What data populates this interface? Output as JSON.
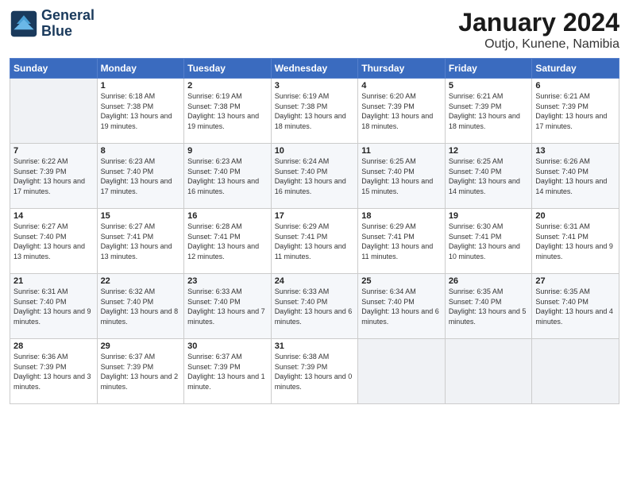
{
  "logo": {
    "line1": "General",
    "line2": "Blue"
  },
  "title": "January 2024",
  "location": "Outjo, Kunene, Namibia",
  "headers": [
    "Sunday",
    "Monday",
    "Tuesday",
    "Wednesday",
    "Thursday",
    "Friday",
    "Saturday"
  ],
  "weeks": [
    [
      {
        "num": "",
        "sunrise": "",
        "sunset": "",
        "daylight": ""
      },
      {
        "num": "1",
        "sunrise": "Sunrise: 6:18 AM",
        "sunset": "Sunset: 7:38 PM",
        "daylight": "Daylight: 13 hours and 19 minutes."
      },
      {
        "num": "2",
        "sunrise": "Sunrise: 6:19 AM",
        "sunset": "Sunset: 7:38 PM",
        "daylight": "Daylight: 13 hours and 19 minutes."
      },
      {
        "num": "3",
        "sunrise": "Sunrise: 6:19 AM",
        "sunset": "Sunset: 7:38 PM",
        "daylight": "Daylight: 13 hours and 18 minutes."
      },
      {
        "num": "4",
        "sunrise": "Sunrise: 6:20 AM",
        "sunset": "Sunset: 7:39 PM",
        "daylight": "Daylight: 13 hours and 18 minutes."
      },
      {
        "num": "5",
        "sunrise": "Sunrise: 6:21 AM",
        "sunset": "Sunset: 7:39 PM",
        "daylight": "Daylight: 13 hours and 18 minutes."
      },
      {
        "num": "6",
        "sunrise": "Sunrise: 6:21 AM",
        "sunset": "Sunset: 7:39 PM",
        "daylight": "Daylight: 13 hours and 17 minutes."
      }
    ],
    [
      {
        "num": "7",
        "sunrise": "Sunrise: 6:22 AM",
        "sunset": "Sunset: 7:39 PM",
        "daylight": "Daylight: 13 hours and 17 minutes."
      },
      {
        "num": "8",
        "sunrise": "Sunrise: 6:23 AM",
        "sunset": "Sunset: 7:40 PM",
        "daylight": "Daylight: 13 hours and 17 minutes."
      },
      {
        "num": "9",
        "sunrise": "Sunrise: 6:23 AM",
        "sunset": "Sunset: 7:40 PM",
        "daylight": "Daylight: 13 hours and 16 minutes."
      },
      {
        "num": "10",
        "sunrise": "Sunrise: 6:24 AM",
        "sunset": "Sunset: 7:40 PM",
        "daylight": "Daylight: 13 hours and 16 minutes."
      },
      {
        "num": "11",
        "sunrise": "Sunrise: 6:25 AM",
        "sunset": "Sunset: 7:40 PM",
        "daylight": "Daylight: 13 hours and 15 minutes."
      },
      {
        "num": "12",
        "sunrise": "Sunrise: 6:25 AM",
        "sunset": "Sunset: 7:40 PM",
        "daylight": "Daylight: 13 hours and 14 minutes."
      },
      {
        "num": "13",
        "sunrise": "Sunrise: 6:26 AM",
        "sunset": "Sunset: 7:40 PM",
        "daylight": "Daylight: 13 hours and 14 minutes."
      }
    ],
    [
      {
        "num": "14",
        "sunrise": "Sunrise: 6:27 AM",
        "sunset": "Sunset: 7:40 PM",
        "daylight": "Daylight: 13 hours and 13 minutes."
      },
      {
        "num": "15",
        "sunrise": "Sunrise: 6:27 AM",
        "sunset": "Sunset: 7:41 PM",
        "daylight": "Daylight: 13 hours and 13 minutes."
      },
      {
        "num": "16",
        "sunrise": "Sunrise: 6:28 AM",
        "sunset": "Sunset: 7:41 PM",
        "daylight": "Daylight: 13 hours and 12 minutes."
      },
      {
        "num": "17",
        "sunrise": "Sunrise: 6:29 AM",
        "sunset": "Sunset: 7:41 PM",
        "daylight": "Daylight: 13 hours and 11 minutes."
      },
      {
        "num": "18",
        "sunrise": "Sunrise: 6:29 AM",
        "sunset": "Sunset: 7:41 PM",
        "daylight": "Daylight: 13 hours and 11 minutes."
      },
      {
        "num": "19",
        "sunrise": "Sunrise: 6:30 AM",
        "sunset": "Sunset: 7:41 PM",
        "daylight": "Daylight: 13 hours and 10 minutes."
      },
      {
        "num": "20",
        "sunrise": "Sunrise: 6:31 AM",
        "sunset": "Sunset: 7:41 PM",
        "daylight": "Daylight: 13 hours and 9 minutes."
      }
    ],
    [
      {
        "num": "21",
        "sunrise": "Sunrise: 6:31 AM",
        "sunset": "Sunset: 7:40 PM",
        "daylight": "Daylight: 13 hours and 9 minutes."
      },
      {
        "num": "22",
        "sunrise": "Sunrise: 6:32 AM",
        "sunset": "Sunset: 7:40 PM",
        "daylight": "Daylight: 13 hours and 8 minutes."
      },
      {
        "num": "23",
        "sunrise": "Sunrise: 6:33 AM",
        "sunset": "Sunset: 7:40 PM",
        "daylight": "Daylight: 13 hours and 7 minutes."
      },
      {
        "num": "24",
        "sunrise": "Sunrise: 6:33 AM",
        "sunset": "Sunset: 7:40 PM",
        "daylight": "Daylight: 13 hours and 6 minutes."
      },
      {
        "num": "25",
        "sunrise": "Sunrise: 6:34 AM",
        "sunset": "Sunset: 7:40 PM",
        "daylight": "Daylight: 13 hours and 6 minutes."
      },
      {
        "num": "26",
        "sunrise": "Sunrise: 6:35 AM",
        "sunset": "Sunset: 7:40 PM",
        "daylight": "Daylight: 13 hours and 5 minutes."
      },
      {
        "num": "27",
        "sunrise": "Sunrise: 6:35 AM",
        "sunset": "Sunset: 7:40 PM",
        "daylight": "Daylight: 13 hours and 4 minutes."
      }
    ],
    [
      {
        "num": "28",
        "sunrise": "Sunrise: 6:36 AM",
        "sunset": "Sunset: 7:39 PM",
        "daylight": "Daylight: 13 hours and 3 minutes."
      },
      {
        "num": "29",
        "sunrise": "Sunrise: 6:37 AM",
        "sunset": "Sunset: 7:39 PM",
        "daylight": "Daylight: 13 hours and 2 minutes."
      },
      {
        "num": "30",
        "sunrise": "Sunrise: 6:37 AM",
        "sunset": "Sunset: 7:39 PM",
        "daylight": "Daylight: 13 hours and 1 minute."
      },
      {
        "num": "31",
        "sunrise": "Sunrise: 6:38 AM",
        "sunset": "Sunset: 7:39 PM",
        "daylight": "Daylight: 13 hours and 0 minutes."
      },
      {
        "num": "",
        "sunrise": "",
        "sunset": "",
        "daylight": ""
      },
      {
        "num": "",
        "sunrise": "",
        "sunset": "",
        "daylight": ""
      },
      {
        "num": "",
        "sunrise": "",
        "sunset": "",
        "daylight": ""
      }
    ]
  ]
}
